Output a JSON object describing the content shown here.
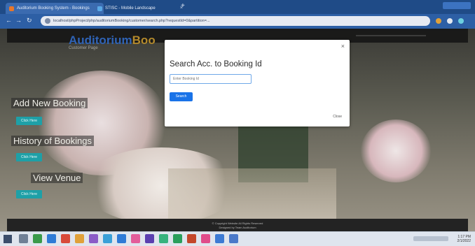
{
  "browser": {
    "tabs": [
      {
        "label": "Auditorium Booking System - Bookings",
        "active": true
      },
      {
        "label": "STISC - Mobile Landscape",
        "active": false
      }
    ],
    "url": "localhost/phpProject/php/auditoriumBooking/customer/search.php?requestId=0&partition=..."
  },
  "page": {
    "brand_part1": "Auditorium",
    "brand_part2": "Boo",
    "subtitle": "Customer Page",
    "sections": [
      {
        "title": "Add New Booking",
        "button": "Click Here"
      },
      {
        "title": "History of Bookings",
        "button": "Click Here"
      },
      {
        "title": "View Venue",
        "button": "Click Here"
      }
    ],
    "footer_line1": "© Copyright Website All Rights Reserved",
    "footer_line2": "Designed by Team Auditorium"
  },
  "modal": {
    "close_glyph": "×",
    "title": "Search Acc. to Booking Id",
    "input_placeholder": "Enter Booking Id",
    "search_label": "Search",
    "close_label": "Close"
  },
  "colors": {
    "brand_blue": "#2f63b6",
    "brand_gold": "#b48a2c",
    "teal_button": "#1ea0a7",
    "primary_button": "#1a73e8"
  },
  "taskbar": {
    "time": "1:17 PM",
    "date": "2/1/2022"
  }
}
